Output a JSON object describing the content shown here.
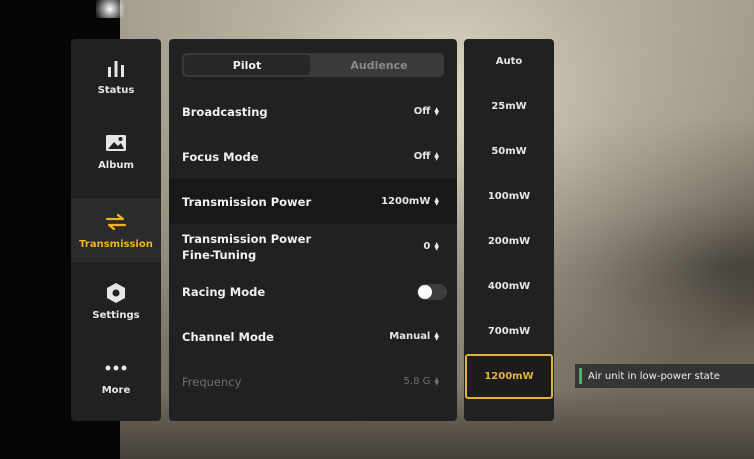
{
  "sidebar": {
    "items": [
      {
        "label": "Status",
        "icon": "bar-chart-icon"
      },
      {
        "label": "Album",
        "icon": "image-icon"
      },
      {
        "label": "Transmission",
        "icon": "swap-arrows-icon"
      },
      {
        "label": "Settings",
        "icon": "hexagon-gear-icon"
      },
      {
        "label": "More",
        "icon": "more-dots-icon"
      }
    ],
    "active": "Transmission"
  },
  "tabs": {
    "pilot": "Pilot",
    "audience": "Audience",
    "active": "Pilot"
  },
  "settings": {
    "broadcasting": {
      "label": "Broadcasting",
      "value": "Off"
    },
    "focus_mode": {
      "label": "Focus Mode",
      "value": "Off"
    },
    "transmission_power": {
      "label": "Transmission Power",
      "value": "1200mW"
    },
    "fine_tuning": {
      "label_line1": "Transmission Power",
      "label_line2": "Fine-Tuning",
      "value": "0"
    },
    "racing_mode": {
      "label": "Racing Mode",
      "enabled": false
    },
    "channel_mode": {
      "label": "Channel Mode",
      "value": "Manual"
    },
    "frequency": {
      "label": "Frequency",
      "value": "5.8 G"
    }
  },
  "power_options": [
    "Auto",
    "25mW",
    "50mW",
    "100mW",
    "200mW",
    "400mW",
    "700mW",
    "1200mW"
  ],
  "power_selected": "1200mW",
  "toast": {
    "message": "Air unit in low-power state"
  },
  "colors": {
    "accent": "#f3b321",
    "panel": "#212121",
    "toast_indicator": "#2fbf71"
  }
}
